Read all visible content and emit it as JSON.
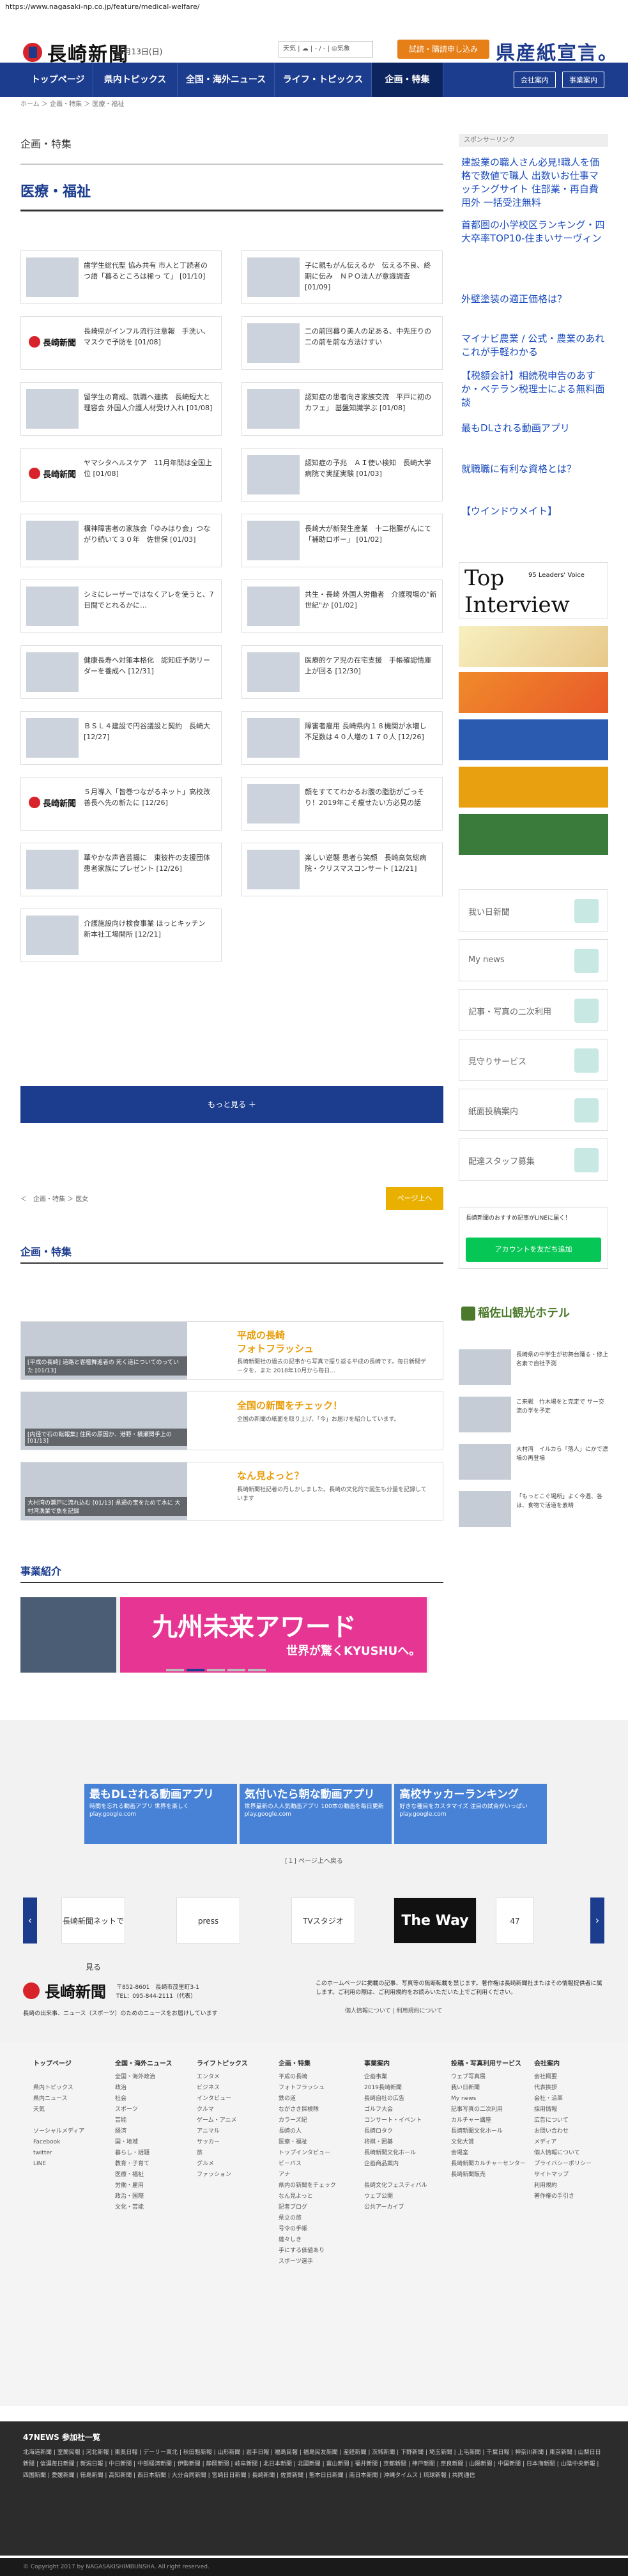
{
  "url": "https://www.nagasaki-np.co.jp/feature/medical-welfare/",
  "site": {
    "logo": "長崎新聞",
    "date": "1月13日(日)",
    "weather": "天気 | ☁ | - / - | ◎気象",
    "trial": "試読・購読申し込み",
    "pref": "県産紙宣言。"
  },
  "nav": {
    "items": [
      "トップページ",
      "県内トピックス",
      "全国・海外ニュース",
      "ライフ・トピックス",
      "企画・特集"
    ],
    "sub": [
      "会社案内",
      "事業案内"
    ]
  },
  "crumb": "ホーム ＞ 企画・特集 ＞ 医療・福祉",
  "page": {
    "section": "企画・特集",
    "title": "医療・福祉"
  },
  "cards": [
    "歯学生総代聖 協み共有 市人と丁読者の　つ語「暮るところは稀っ て」 [01/10]",
    "子に親もがん伝えるか　伝える不良、終期に伝み　ＮＰＯ法人が意識調査 [01/09]",
    "長崎県がインフル流行注意報　手洗い、マスクで予防を [01/08]",
    "二の前回暮り美人の足ある、中先圧りの二の前を前な方法けすい",
    "留学生の育成、就職へ連携　長崎短大と理容会 外国人介護人材受け入れ [01/08]",
    "認知症の患者向き家族交流　平戸に初のカフェ」 基盤知識学ぶ [01/08]",
    "ヤマシタヘルスケア　11月年間は全国上位 [01/08]",
    "認知症の予兆　ＡＩ使い検知　長崎大学病院で実証実験 [01/03]",
    "構神障害者の家族会「ゆみはり会」つながり続いて３０年　佐世保 [01/03]",
    "長崎大が新発生産業　十二指腸がんにて「補助ロボー」 [01/02]",
    "シミにレーザーではなくアレを使うと、7日間でとれるかに…",
    "共生・長崎 外国人労働者　介護現場の\"新世紀\"か [01/02]",
    "健康長寿へ対策本格化　認知症予防リーダーを養成へ [12/31]",
    "医療的ケア児の在宅支援　手帳確認情庫上が回る [12/30]",
    "ＢＳＬ４建設で円谷議設と契約　長崎大 [12/27]",
    "障害者雇用 長崎県内１８機関が水増し　不足数は４０人増の１７０人 [12/26]",
    "５月導入「皆巻つながるネット」高校改善長へ先の新たに [12/26]",
    "顔をすててわかるお腹の脂肪がごっそり！2019年こそ痩せたい方必見の話",
    "華やかな声音芸撮に　東彼杵の支援団体 患者家族にプレゼント [12/26]",
    "楽しい逆襲 患者ら笑顔　長崎高気総病院・クリスマスコンサート [12/21]",
    "介護施設向け検食事業 ほっとキッチン　新本社工場開所 [12/21]"
  ],
  "more": "もっと見る ＋",
  "pager": {
    "left": "＜　企画・特集 ＞ 医女",
    "right": "ページ上へ"
  },
  "plans": {
    "heading": "企画・特集",
    "rows": [
      {
        "cap": "[平成の長崎] 道路と客艦舞進者の 死く道についてのっていた [01/13]",
        "title": "平成の長崎\nフォトフラッシュ",
        "desc": "長崎新聞社の過去の記事から写真で振り返る平成の長崎です。毎日新聞データを、また 2018年10月から毎日…"
      },
      {
        "cap": "[内径で石の転報集] 住民の原因か、港野・橋瀬関手上の [01/13]",
        "title": "全国の新聞をチェック！",
        "desc": "全国の新聞の紙面を取り上げ、「今」お届けを紹介しています。"
      },
      {
        "cap": "大村湾の瀬戸に流れ込む [01/13] 県通の宝をためて水に 大村湾漁業で魚を記録",
        "title": "なん見よっと？",
        "desc": "長崎新聞社記者の丹しかしました。長崎の文化的で誕生も分量を記録しています"
      }
    ]
  },
  "biz": {
    "heading": "事業紹介",
    "banner_title": "九州未来アワード",
    "banner_sub": "世界が驚くKYUSHUへ。"
  },
  "sidebar": {
    "sponsor": "スポンサーリンク",
    "ads": [
      {
        "t": "建設業の職人さん必見!職人を価格で数値で職人 出数いお仕事マッチングサイト 住部業・再自費用外 一括受注無料",
        "u": "www.xxx.co.jp"
      },
      {
        "t": "首都圏の小学校区ランキング・四大卒率TOP10-住まいサーヴィン",
        "u": ""
      },
      {
        "t": "外壁塗装の適正価格は？",
        "u": ""
      },
      {
        "t": "マイナビ農業 / 公式・農業のあれこれが手軽わかる",
        "u": ""
      },
      {
        "t": "【税額会計】相続税申告のあすか・ベテラン税理士による無料面談",
        "u": ""
      },
      {
        "t": "最もDLされる動画アプリ",
        "u": ""
      },
      {
        "t": "就職職に有利な資格とは？",
        "u": ""
      },
      {
        "t": "【ウインドウメイト】",
        "u": ""
      }
    ],
    "topi": {
      "a": "Top",
      "b": "Interview",
      "c": "95 Leaders' Voice"
    },
    "list": [
      "我い日新聞",
      "My news",
      "記事・写真の二次利用",
      "見守りサービス",
      "紙面投稿案内",
      "配達スタッフ募集"
    ],
    "line_note": "長崎新聞のおすすめ記事がLINEに届く！",
    "line_btn": "アカウントを友だち追加",
    "hotel": "稲佐山観光ホテル",
    "news": [
      "長崎県の中学生が初舞台踊る・修上名素で自社予測",
      "こ来戦　竹木場をと完定で サー交流の学を予定",
      "大村湾　イルカら「落人」にかで漂場の再登場",
      "「もっとこぐ場所」よく今週、各ほ、食物で活道を素晴"
    ]
  },
  "google_ads": [
    {
      "t": "最もDLされる動画アプリ",
      "d": "時間を忘れる動画アプリ 世界を楽しく play.google.com"
    },
    {
      "t": "気付いたら朝な動画アプリ",
      "d": "世界最新の人人気動画アプリ 100本の動画を毎日更新 play.google.com"
    },
    {
      "t": "高校サッカーランキング",
      "d": "好きな種目をカスタマイズ 注目の試合がいっぱい play.google.com"
    }
  ],
  "gcap": "[１] ページ上へ戻る",
  "carousel": [
    "長崎新聞ネットで見る",
    "press",
    "TVスタジオ",
    "The Way",
    "47"
  ],
  "footer": {
    "logo": "長崎新聞",
    "addr": "〒852-8601　長崎市茂里町3-1\nTEL：095-844-2111（代表）",
    "slogan": "長崎の出来事、ニュース（スポーツ）のためのニュースをお届けしています",
    "note": "このホームページに掲載の記事、写真等の無断転載を禁じます。著作権は長崎新聞社またはその情報提供者に属します。ご利用の際は、ご利用規約をお読みいただいた上でご利用ください。",
    "links": "個人情報について | 利用規約について"
  },
  "sitemap": [
    {
      "h": "トップページ",
      "i": [
        "",
        "県内トピックス",
        "県内ニュース",
        "天気",
        "",
        "ソーシャルメディア",
        "Facebook",
        "twitter",
        "LINE"
      ]
    },
    {
      "h": "全国・海外ニュース",
      "i": [
        "全国・海外政治",
        "政治",
        "社会",
        "スポーツ",
        "芸能",
        "経済",
        "国・地域",
        "暮らし・話題",
        "教育・子育て",
        "医療・福祉",
        "労働・雇用",
        "政治・国際",
        "文化・芸能"
      ]
    },
    {
      "h": "ライフトピックス",
      "i": [
        "エンタメ",
        "ビジネス",
        "インタビュー",
        "クルマ",
        "ゲーム・アニメ",
        "アニマル",
        "サッカー",
        "旅",
        "グルメ",
        "ファッション"
      ]
    },
    {
      "h": "企画・特集",
      "i": [
        "平成の長崎",
        "フォトフラッシュ",
        "鉄の道",
        "ながさき探検隊",
        "カラーズ紀",
        "長崎の人",
        "医療・福祉",
        "トップインタビュー",
        "ビーバス",
        "アナ",
        "県内の新聞をチェック",
        "なん見よっと",
        "記者ブログ",
        "県立の旅",
        "号令の手帳",
        "雄々しき",
        "手にする価値あり",
        "スポーツ選手"
      ]
    },
    {
      "h": "事業案内",
      "i": [
        "企画事業",
        "2019長崎新聞",
        "長崎自社の広告",
        "ゴルフ大会",
        "コンサート・イベント",
        "長崎ロタク",
        "将棋・囲碁",
        "長崎新聞文化ホール",
        "企画商品案内",
        "",
        "長崎文化フェスティバル",
        "ウェブ公開",
        "公共アーカイブ"
      ]
    },
    {
      "h": "投稿・写真利用サービス",
      "i": [
        "ウェブ写真展",
        "我い日新聞",
        "My news",
        "記事写真の二次利用",
        "カルチャー講座",
        "長崎新聞文化ホール",
        "文化大賞",
        "会場室",
        "長崎新聞カルチャーセンター",
        "長崎新聞販売"
      ]
    },
    {
      "h": "会社案内",
      "i": [
        "会社概要",
        "代表挨拶",
        "会社・沿革",
        "採用情報",
        "広告について",
        "お問い合わせ",
        "メディア",
        "個人情報について",
        "プライバシーポリシー",
        "サイトマップ",
        "利用規約",
        "著作権の手引き"
      ]
    }
  ],
  "n47": {
    "heading": "47NEWS 参加社一覧",
    "links": "北海道新聞 | 室蘭民報 | 河北新報 | 東奥日報 | デーリー東北 | 秋田魁新報 | 山形新聞 | 岩手日報 | 福島民報 | 福島民友新聞 | 産経新聞 | 茨城新聞 | 下野新聞 | 埼玉新聞 | 上毛新聞 | 千葉日報 | 神奈川新聞 | 東京新聞 | 山梨日日新聞 | 信濃毎日新聞 | 新潟日報 | 中日新聞 | 中部経済新聞 | 伊勢新聞 | 静岡新聞 | 岐阜新聞 | 北日本新聞 | 北國新聞 | 富山新聞 | 福井新聞 | 京都新聞 | 神戸新聞 | 奈良新聞 | 山陽新聞 | 中国新聞 | 日本海新聞 | 山陰中央新報 | 四国新聞 | 愛媛新聞 | 徳島新聞 | 高知新聞 | 西日本新聞 | 大分合同新聞 | 宮崎日日新聞 | 長崎新聞 | 佐賀新聞 | 熊本日日新聞 | 南日本新聞 | 沖縄タイムス | 琉球新報 | 共同通信"
  },
  "copyright": "© Copyright 2017 by NAGASAKISHIMBUNSHA. All right reserved."
}
